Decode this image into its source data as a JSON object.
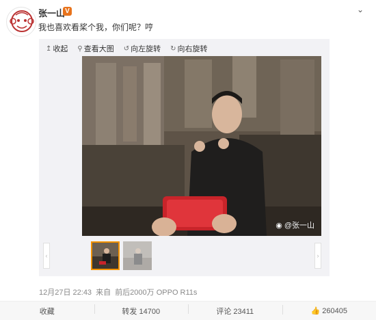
{
  "user": {
    "name": "张一山",
    "verified_badge": "V",
    "avatar_icon": "monkey-avatar-icon",
    "badge_color": "#e8731c"
  },
  "post": {
    "text": "我也喜欢看桨个我，你们呢？哼",
    "more_icon": "chevron-down-icon"
  },
  "media_toolbar": {
    "collapse": "收起",
    "view_large": "查看大图",
    "rotate_left": "向左旋转",
    "rotate_right": "向右旋转"
  },
  "photo": {
    "watermark": "@张一山"
  },
  "meta": {
    "time": "12月27日 22:43",
    "source_prefix": "来自",
    "source": "前后2000万 OPPO R11s"
  },
  "actions": {
    "favorite": "收藏",
    "repost": "转发 14700",
    "comment": "评论 23411",
    "like": "260405"
  },
  "colors": {
    "accent": "#f29100",
    "toolbar_bg": "#f2f2f5"
  }
}
